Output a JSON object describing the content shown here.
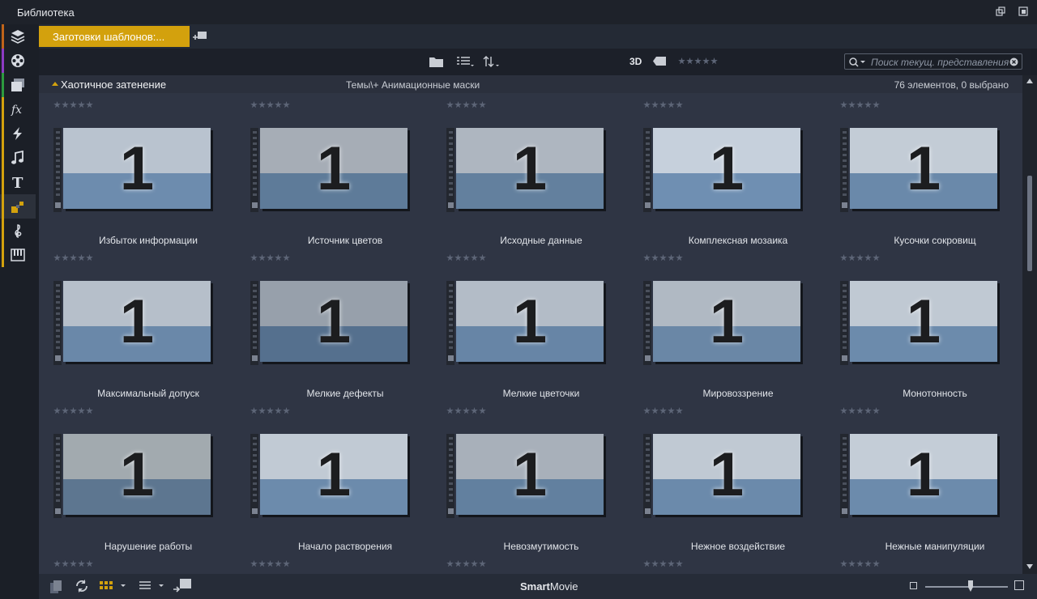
{
  "window": {
    "title": "Библиотека"
  },
  "sidebar": {
    "items": [
      {
        "icon": "layers-icon",
        "stripe": "#c0641a"
      },
      {
        "icon": "film-reel-icon",
        "stripe": "#8d3bc4"
      },
      {
        "icon": "photos-icon",
        "stripe": "#2c9a3f"
      },
      {
        "icon": "fx-icon",
        "stripe": "#d3a10d"
      },
      {
        "icon": "lightning-icon",
        "stripe": "#d3a10d"
      },
      {
        "icon": "music-note-icon",
        "stripe": "#d3a10d"
      },
      {
        "icon": "text-title-icon",
        "stripe": "#d3a10d"
      },
      {
        "icon": "montage-icon",
        "stripe": "#d3a10d"
      },
      {
        "icon": "treble-clef-icon",
        "stripe": "#d3a10d"
      },
      {
        "icon": "piano-keys-icon",
        "stripe": "#d3a10d"
      }
    ],
    "active_index": 7
  },
  "tabs": {
    "preset_label": "Заготовки шаблонов:..."
  },
  "toolbar": {
    "three_d_label": "3D",
    "search_placeholder": "Поиск текущ. представления"
  },
  "group_header": {
    "name": "Хаотичное затенение",
    "path": "Темы\\+ Анимационные маски",
    "count": "76 элементов, 0 выбрано"
  },
  "items": [
    {
      "label": "Избыток информации",
      "top": "#b9c3cf",
      "bottom": "#6d8cae",
      "rating": 0
    },
    {
      "label": "Источник цветов",
      "top": "#a6adb6",
      "bottom": "#5e7b99",
      "rating": 0
    },
    {
      "label": "Исходные данные",
      "top": "#aeb6c0",
      "bottom": "#63809e",
      "rating": 0
    },
    {
      "label": "Комплексная мозаика",
      "top": "#c6d0dc",
      "bottom": "#6f8fb2",
      "rating": 0
    },
    {
      "label": "Кусочки сокровищ",
      "top": "#c3ccd6",
      "bottom": "#6a89aa",
      "rating": 0
    },
    {
      "label": "Максимальный допуск",
      "top": "#b6bfca",
      "bottom": "#6a88a9",
      "rating": 0
    },
    {
      "label": "Мелкие дефекты",
      "top": "#97a0ab",
      "bottom": "#55708e",
      "rating": 0
    },
    {
      "label": "Мелкие цветочки",
      "top": "#b3bcc7",
      "bottom": "#6785a6",
      "rating": 0
    },
    {
      "label": "Мировоззрение",
      "top": "#b0b9c3",
      "bottom": "#6a87a6",
      "rating": 0
    },
    {
      "label": "Монотонность",
      "top": "#c0c9d3",
      "bottom": "#6c8bac",
      "rating": 0
    },
    {
      "label": "Нарушение работы",
      "top": "#a2aaaf",
      "bottom": "#5d7690",
      "rating": 0
    },
    {
      "label": "Начало растворения",
      "top": "#c1cad4",
      "bottom": "#6c8bac",
      "rating": 0
    },
    {
      "label": "Невозмутимость",
      "top": "#a8b0ba",
      "bottom": "#62809f",
      "rating": 0
    },
    {
      "label": "Нежное воздействие",
      "top": "#c0c9d3",
      "bottom": "#6b8aab",
      "rating": 0
    },
    {
      "label": "Нежные манипуляции",
      "top": "#c4cdd7",
      "bottom": "#6c8bac",
      "rating": 0
    }
  ],
  "thumbnail_text": "1",
  "bottom_bar": {
    "brand_bold": "Smart",
    "brand_normal": "Movie",
    "zoom_level": 0.55
  }
}
